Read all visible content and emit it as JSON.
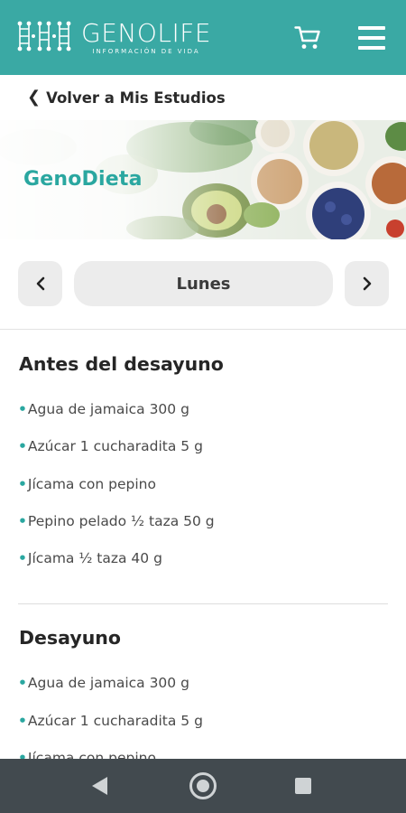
{
  "header": {
    "brand_name": "GENOLIFE",
    "brand_tagline": "INFORMACIÓN DE VIDA",
    "brand_color": "#3aa9a4",
    "cart_icon": "cart-icon",
    "menu_icon": "hamburger-menu-icon"
  },
  "back_link": {
    "label": "Volver a Mis Estudios"
  },
  "hero": {
    "title": "GenoDieta",
    "title_color": "#2aa7a0"
  },
  "day_selector": {
    "prev_icon": "chevron-left-icon",
    "day": "Lunes",
    "next_icon": "chevron-right-icon"
  },
  "sections": [
    {
      "title": "Antes del desayuno",
      "items": [
        "Agua de jamaica 300 g",
        "Azúcar 1 cucharadita 5 g",
        "Jícama con pepino",
        "Pepino pelado ½ taza 50 g",
        "Jícama ½ taza 40 g"
      ]
    },
    {
      "title": "Desayuno",
      "items": [
        "Agua de jamaica 300 g",
        "Azúcar 1 cucharadita 5 g",
        "Jícama con pepino"
      ]
    }
  ],
  "bullet": "•",
  "system_nav": {
    "back_icon": "back-triangle-icon",
    "home_icon": "home-circle-icon",
    "recents_icon": "recents-square-icon"
  }
}
